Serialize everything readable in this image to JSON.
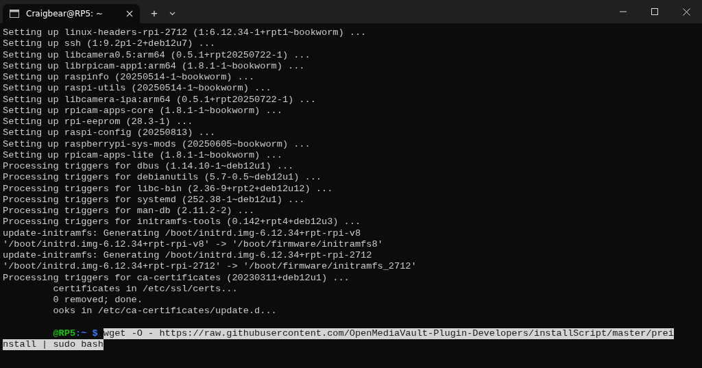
{
  "window": {
    "tab": {
      "title": "Craigbear@RP5: ~",
      "selected": true
    },
    "new_tab": "+"
  },
  "terminal": {
    "lines": [
      {
        "kind": "output",
        "text": "Setting up linux-headers-rpi-2712 (1:6.12.34-1+rpt1~bookworm) ..."
      },
      {
        "kind": "output",
        "text": "Setting up ssh (1:9.2p1-2+deb12u7) ..."
      },
      {
        "kind": "output",
        "text": "Setting up libcamera0.5:arm64 (0.5.1+rpt20250722-1) ..."
      },
      {
        "kind": "output",
        "text": "Setting up librpicam-app1:arm64 (1.8.1-1~bookworm) ..."
      },
      {
        "kind": "output",
        "text": "Setting up raspinfo (20250514-1~bookworm) ..."
      },
      {
        "kind": "output",
        "text": "Setting up raspi-utils (20250514-1~bookworm) ..."
      },
      {
        "kind": "output",
        "text": "Setting up libcamera-ipa:arm64 (0.5.1+rpt20250722-1) ..."
      },
      {
        "kind": "output",
        "text": "Setting up rpicam-apps-core (1.8.1-1~bookworm) ..."
      },
      {
        "kind": "output",
        "text": "Setting up rpi-eeprom (28.3-1) ..."
      },
      {
        "kind": "output",
        "text": "Setting up raspi-config (20250813) ..."
      },
      {
        "kind": "output",
        "text": "Setting up raspberrypi-sys-mods (20250605~bookworm) ..."
      },
      {
        "kind": "output",
        "text": "Setting up rpicam-apps-lite (1.8.1-1~bookworm) ..."
      },
      {
        "kind": "output",
        "text": "Processing triggers for dbus (1.14.10-1~deb12u1) ..."
      },
      {
        "kind": "output",
        "text": "Processing triggers for debianutils (5.7-0.5~deb12u1) ..."
      },
      {
        "kind": "output",
        "text": "Processing triggers for libc-bin (2.36-9+rpt2+deb12u12) ..."
      },
      {
        "kind": "output",
        "text": "Processing triggers for systemd (252.38-1~deb12u1) ..."
      },
      {
        "kind": "output",
        "text": "Processing triggers for man-db (2.11.2-2) ..."
      },
      {
        "kind": "output",
        "text": "Processing triggers for initramfs-tools (0.142+rpt4+deb12u3) ..."
      },
      {
        "kind": "output",
        "text": "update-initramfs: Generating /boot/initrd.img-6.12.34+rpt-rpi-v8"
      },
      {
        "kind": "output",
        "text": "'/boot/initrd.img-6.12.34+rpt-rpi-v8' -> '/boot/firmware/initramfs8'"
      },
      {
        "kind": "output",
        "text": "update-initramfs: Generating /boot/initrd.img-6.12.34+rpt-rpi-2712"
      },
      {
        "kind": "output",
        "text": "'/boot/initrd.img-6.12.34+rpt-rpi-2712' -> '/boot/firmware/initramfs_2712'"
      },
      {
        "kind": "output",
        "text": "Processing triggers for ca-certificates (20230311+deb12u1) ..."
      },
      {
        "kind": "partial",
        "text": "certificates in /etc/ssl/certs..."
      },
      {
        "kind": "partial",
        "text": "0 removed; done."
      },
      {
        "kind": "partial",
        "text": "ooks in /etc/ca-certificates/update.d..."
      },
      {
        "kind": "blank"
      },
      {
        "kind": "prompt",
        "host": "@RP5",
        "path": ":~",
        "symbol": "$",
        "command": "wget -O - https://raw.githubusercontent.com/OpenMediaVault-Plugin-Developers/installScript/master/prei",
        "selected": true
      },
      {
        "kind": "continuation",
        "command": "nstall | sudo bash",
        "selected": true
      }
    ]
  }
}
